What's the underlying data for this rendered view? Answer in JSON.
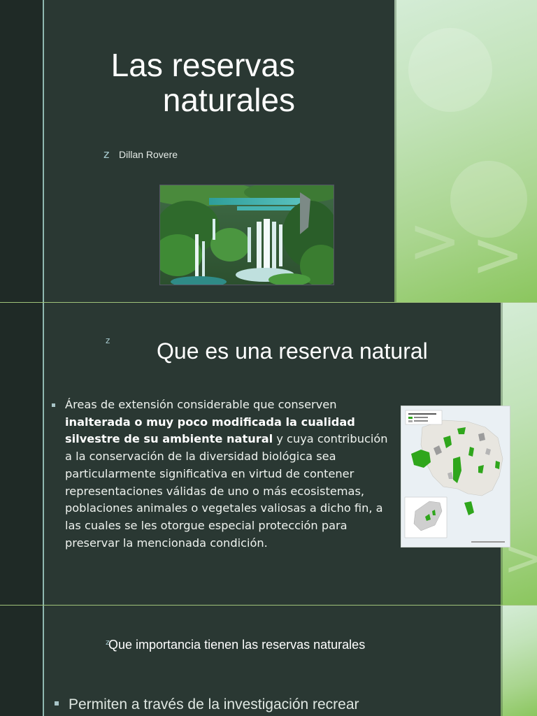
{
  "slide1": {
    "title_line1": "Las reservas",
    "title_line2": "naturales",
    "bullet_glyph": "z",
    "author": "Dillan Rovere",
    "image_icon": "waterfall-photo"
  },
  "slide2": {
    "bullet_glyph": "z",
    "heading": "Que es una reserva natural",
    "paragraph": {
      "part1": "Áreas de extensión considerable que conserven ",
      "bold": "inalterada o muy poco modificada la cualidad silvestre de su ambiente natural",
      "part2": " y cuya contribución a la conservación de la diversidad biológica sea particularmente significativa en virtud de contener representaciones válidas de uno o más ecosistemas, poblaciones animales o vegetales valiosas a dicho fin, a las cuales se les otorgue especial protección para preservar la mencionada condición."
    },
    "map_icon": "reserves-map"
  },
  "slide3": {
    "bullet_glyph": "z",
    "heading": "Que importancia tienen las reservas naturales",
    "bullet1": "Permiten a través de la investigación recrear"
  },
  "colors": {
    "slide_bg": "#2a3833",
    "left_bar": "#1f2a26",
    "accent_line": "#8fb8b0",
    "green_panel": "#a9d58e",
    "map_reserve": "#2fa61c"
  }
}
